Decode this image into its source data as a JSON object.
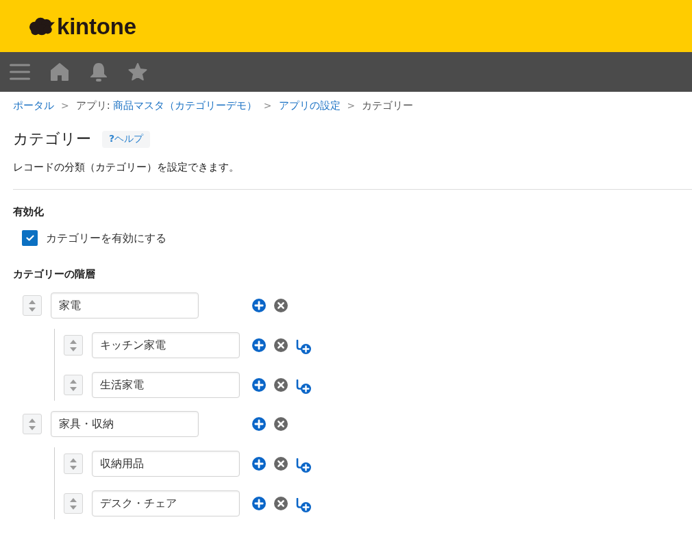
{
  "header": {
    "logo_text": "kintone"
  },
  "breadcrumb": [
    {
      "kind": "link",
      "text": "ポータル"
    },
    {
      "kind": "separator",
      "text": ">"
    },
    {
      "kind": "label",
      "text": "アプリ:"
    },
    {
      "kind": "link",
      "text": "商品マスタ（カテゴリーデモ）"
    },
    {
      "kind": "separator",
      "text": ">"
    },
    {
      "kind": "link",
      "text": "アプリの設定"
    },
    {
      "kind": "separator",
      "text": ">"
    },
    {
      "kind": "current",
      "text": "カテゴリー"
    }
  ],
  "page": {
    "title": "カテゴリー",
    "help_button": "**?**ヘルプ",
    "description": "レコードの分類（カテゴリー）を設定できます。"
  },
  "enable_section": {
    "heading": "有効化",
    "checkbox": {
      "label": "カテゴリーを有効にする",
      "checked": true
    }
  },
  "hierarchy": {
    "heading": "カテゴリーの階層",
    "categories": [
      {
        "value": "家電",
        "children": [
          {
            "value": "キッチン家電"
          },
          {
            "value": "生活家電"
          }
        ]
      },
      {
        "value": "家具・収納",
        "children": [
          {
            "value": "収納用品"
          },
          {
            "value": "デスク・チェア"
          }
        ]
      }
    ]
  }
}
